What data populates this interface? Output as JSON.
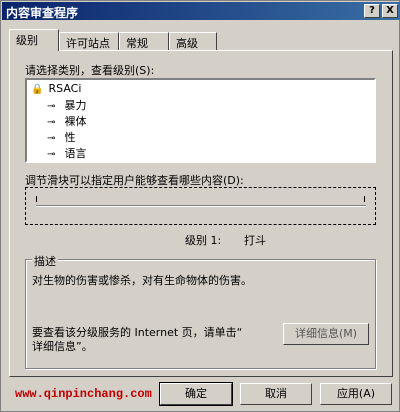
{
  "window": {
    "title": "内容审查程序",
    "help_button": "?",
    "close_button": "X"
  },
  "tabs": [
    {
      "label": "级别",
      "active": true
    },
    {
      "label": "许可站点",
      "active": false
    },
    {
      "label": "常规",
      "active": false
    },
    {
      "label": "高级",
      "active": false
    }
  ],
  "ratings": {
    "category_label": "请选择类别，查看级别(S):",
    "root": "RSACi",
    "items": [
      {
        "label": "暴力",
        "selected": true
      },
      {
        "label": "裸体",
        "selected": false
      },
      {
        "label": "性",
        "selected": false
      },
      {
        "label": "语言",
        "selected": false
      }
    ]
  },
  "slider": {
    "label": "调节滑块可以指定用户能够查看哪些内容(D):",
    "level_text": "级别 1:",
    "level_value": "打斗"
  },
  "description": {
    "legend": "描述",
    "text": "对生物的伤害或惨杀，对有生命物体的伤害。",
    "more_info_text_line1": "要查看该分级服务的 Internet 页，请单击“",
    "more_info_text_line2": "详细信息”。",
    "detail_button": "详细信息(M)"
  },
  "buttons": {
    "ok": "确定",
    "cancel": "取消",
    "apply": "应用(A)"
  },
  "watermark": "www.qinpinchang.com"
}
